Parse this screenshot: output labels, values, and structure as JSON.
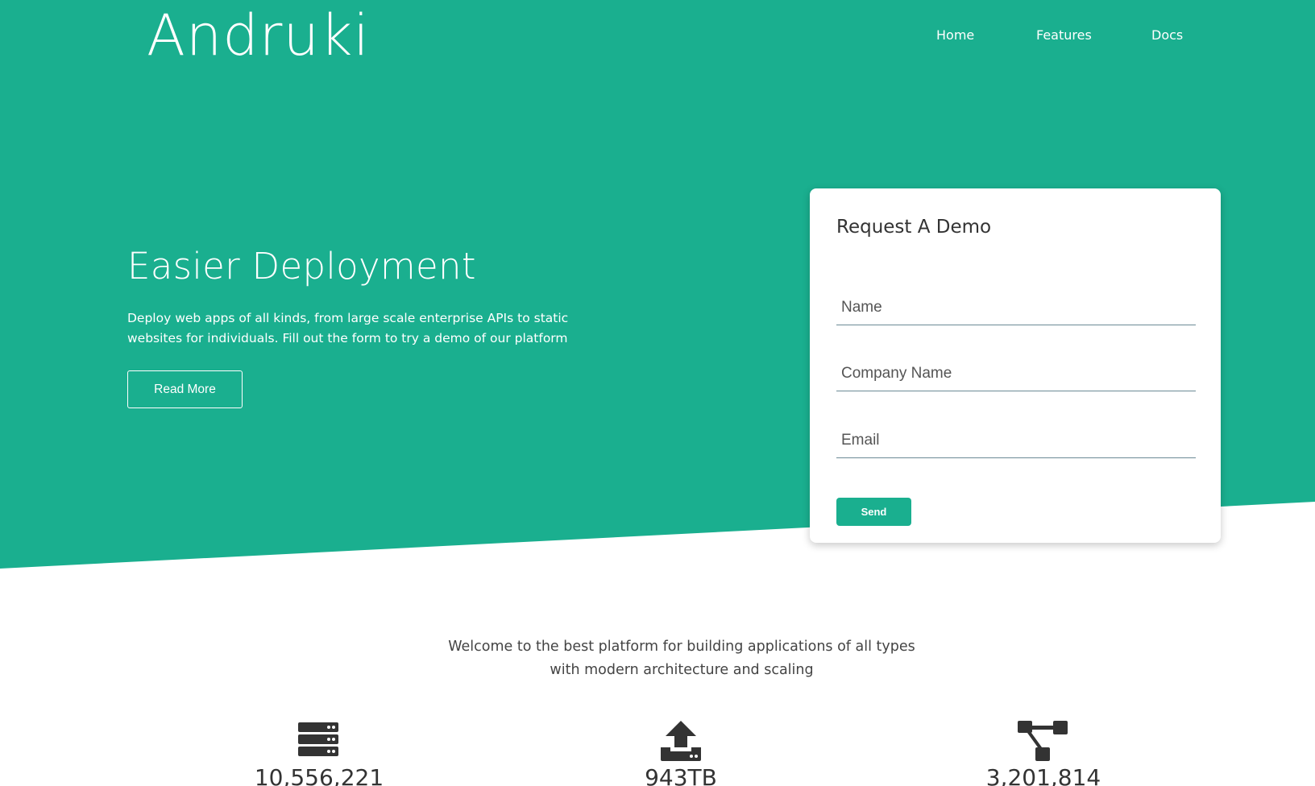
{
  "brand": {
    "name": "Andruki"
  },
  "nav": {
    "home": "Home",
    "features": "Features",
    "docs": "Docs"
  },
  "hero": {
    "title": "Easier Deployment",
    "text": "Deploy web apps of all kinds, from large scale enterprise APIs to static websites for individuals. Fill out the form to try a demo of our platform",
    "read_more": "Read More"
  },
  "demo_form": {
    "title": "Request A Demo",
    "name_placeholder": "Name",
    "company_placeholder": "Company Name",
    "email_placeholder": "Email",
    "send": "Send"
  },
  "welcome": {
    "line1": "Welcome to the best platform for building applications of all types",
    "line2": "with modern architecture and scaling"
  },
  "stats": [
    {
      "icon": "server-icon",
      "value": "10,556,221"
    },
    {
      "icon": "upload-icon",
      "value": "943TB"
    },
    {
      "icon": "sitemap-icon",
      "value": "3,201,814"
    }
  ],
  "colors": {
    "accent": "#1aaf8f",
    "text": "#333333",
    "white": "#ffffff"
  }
}
